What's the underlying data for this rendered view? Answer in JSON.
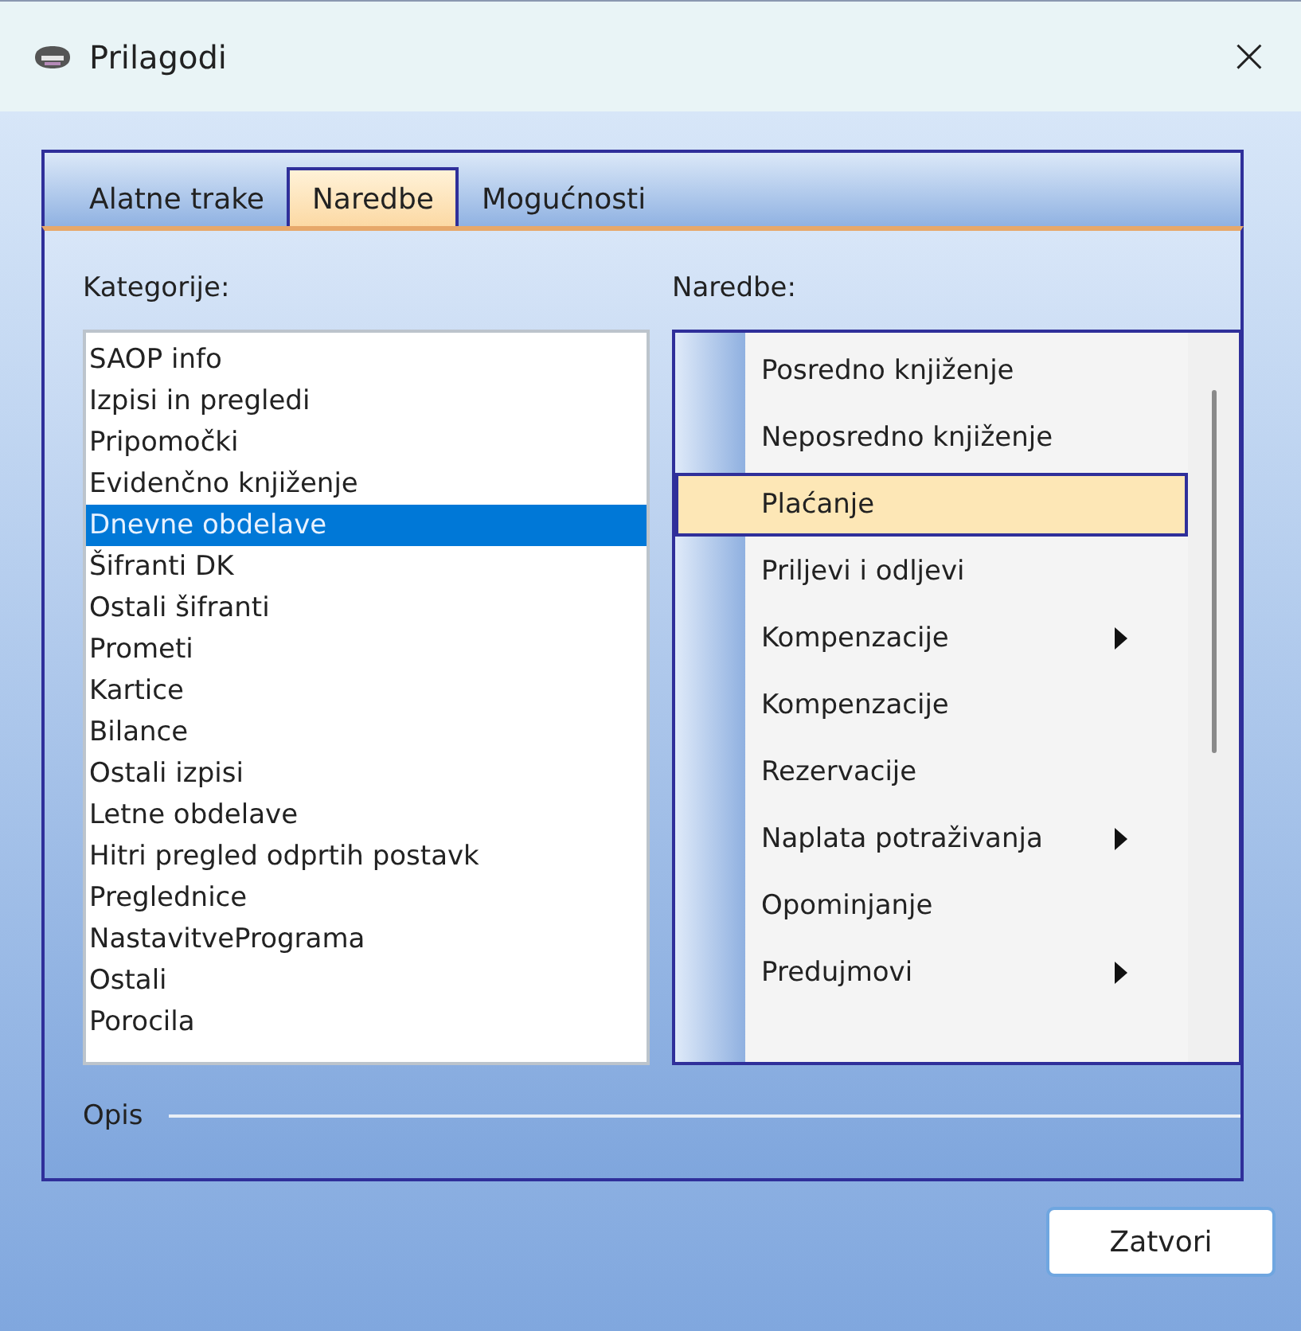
{
  "window": {
    "title": "Prilagodi",
    "close": "×"
  },
  "tabs": [
    {
      "label": "Alatne trake",
      "selected": false
    },
    {
      "label": "Naredbe",
      "selected": true
    },
    {
      "label": "Mogućnosti",
      "selected": false
    }
  ],
  "categories": {
    "label": "Kategorije:",
    "items": [
      {
        "label": "SAOP info",
        "selected": false
      },
      {
        "label": "Izpisi in pregledi",
        "selected": false
      },
      {
        "label": "Pripomočki",
        "selected": false
      },
      {
        "label": "Evidenčno knjiženje",
        "selected": false
      },
      {
        "label": "Dnevne obdelave",
        "selected": true
      },
      {
        "label": "Šifranti DK",
        "selected": false
      },
      {
        "label": "Ostali šifranti",
        "selected": false
      },
      {
        "label": "Prometi",
        "selected": false
      },
      {
        "label": "Kartice",
        "selected": false
      },
      {
        "label": "Bilance",
        "selected": false
      },
      {
        "label": "Ostali izpisi",
        "selected": false
      },
      {
        "label": "Letne obdelave",
        "selected": false
      },
      {
        "label": "Hitri pregled odprtih postavk",
        "selected": false
      },
      {
        "label": "Preglednice",
        "selected": false
      },
      {
        "label": "NastavitvePrograma",
        "selected": false
      },
      {
        "label": "Ostali",
        "selected": false
      },
      {
        "label": "Porocila",
        "selected": false
      }
    ]
  },
  "commands": {
    "label": "Naredbe:",
    "items": [
      {
        "label": "Posredno knjiženje",
        "selected": false,
        "submenu": false
      },
      {
        "label": "Neposredno knjiženje",
        "selected": false,
        "submenu": false
      },
      {
        "label": "Plaćanje",
        "selected": true,
        "submenu": false
      },
      {
        "label": "Priljevi i odljevi",
        "selected": false,
        "submenu": false
      },
      {
        "label": "Kompenzacije",
        "selected": false,
        "submenu": true
      },
      {
        "label": "Kompenzacije",
        "selected": false,
        "submenu": false
      },
      {
        "label": "Rezervacije",
        "selected": false,
        "submenu": false
      },
      {
        "label": "Naplata potraživanja",
        "selected": false,
        "submenu": true
      },
      {
        "label": "Opominjanje",
        "selected": false,
        "submenu": false
      },
      {
        "label": "Predujmovi",
        "selected": false,
        "submenu": true
      }
    ]
  },
  "description": {
    "label": "Opis"
  },
  "buttons": [
    {
      "label": "Zatvori"
    }
  ]
}
